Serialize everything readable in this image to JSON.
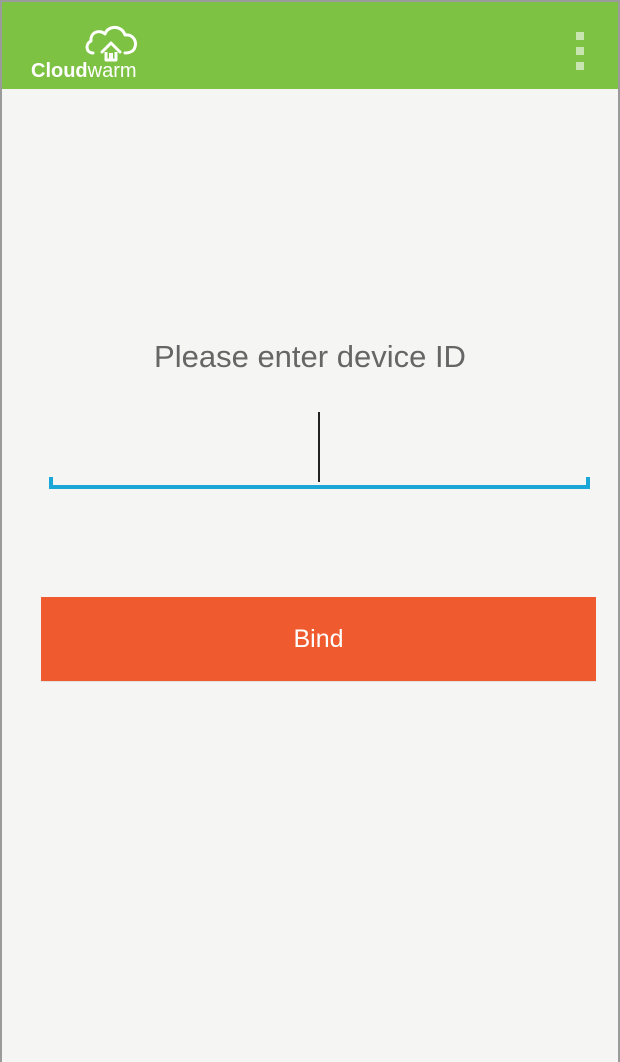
{
  "appbar": {
    "brand_primary": "Cloud",
    "brand_secondary": "warm",
    "brand_color": "#7dc242",
    "menu_icon": "more-vertical-icon",
    "logo_icon": "cloud-home-icon"
  },
  "main": {
    "prompt": "Please enter device ID",
    "device_input_value": "",
    "device_input_placeholder": "",
    "bind_label": "Bind",
    "input_accent": "#1aa7d8",
    "button_color": "#ef5b2f",
    "background_color": "#f5f5f4"
  }
}
